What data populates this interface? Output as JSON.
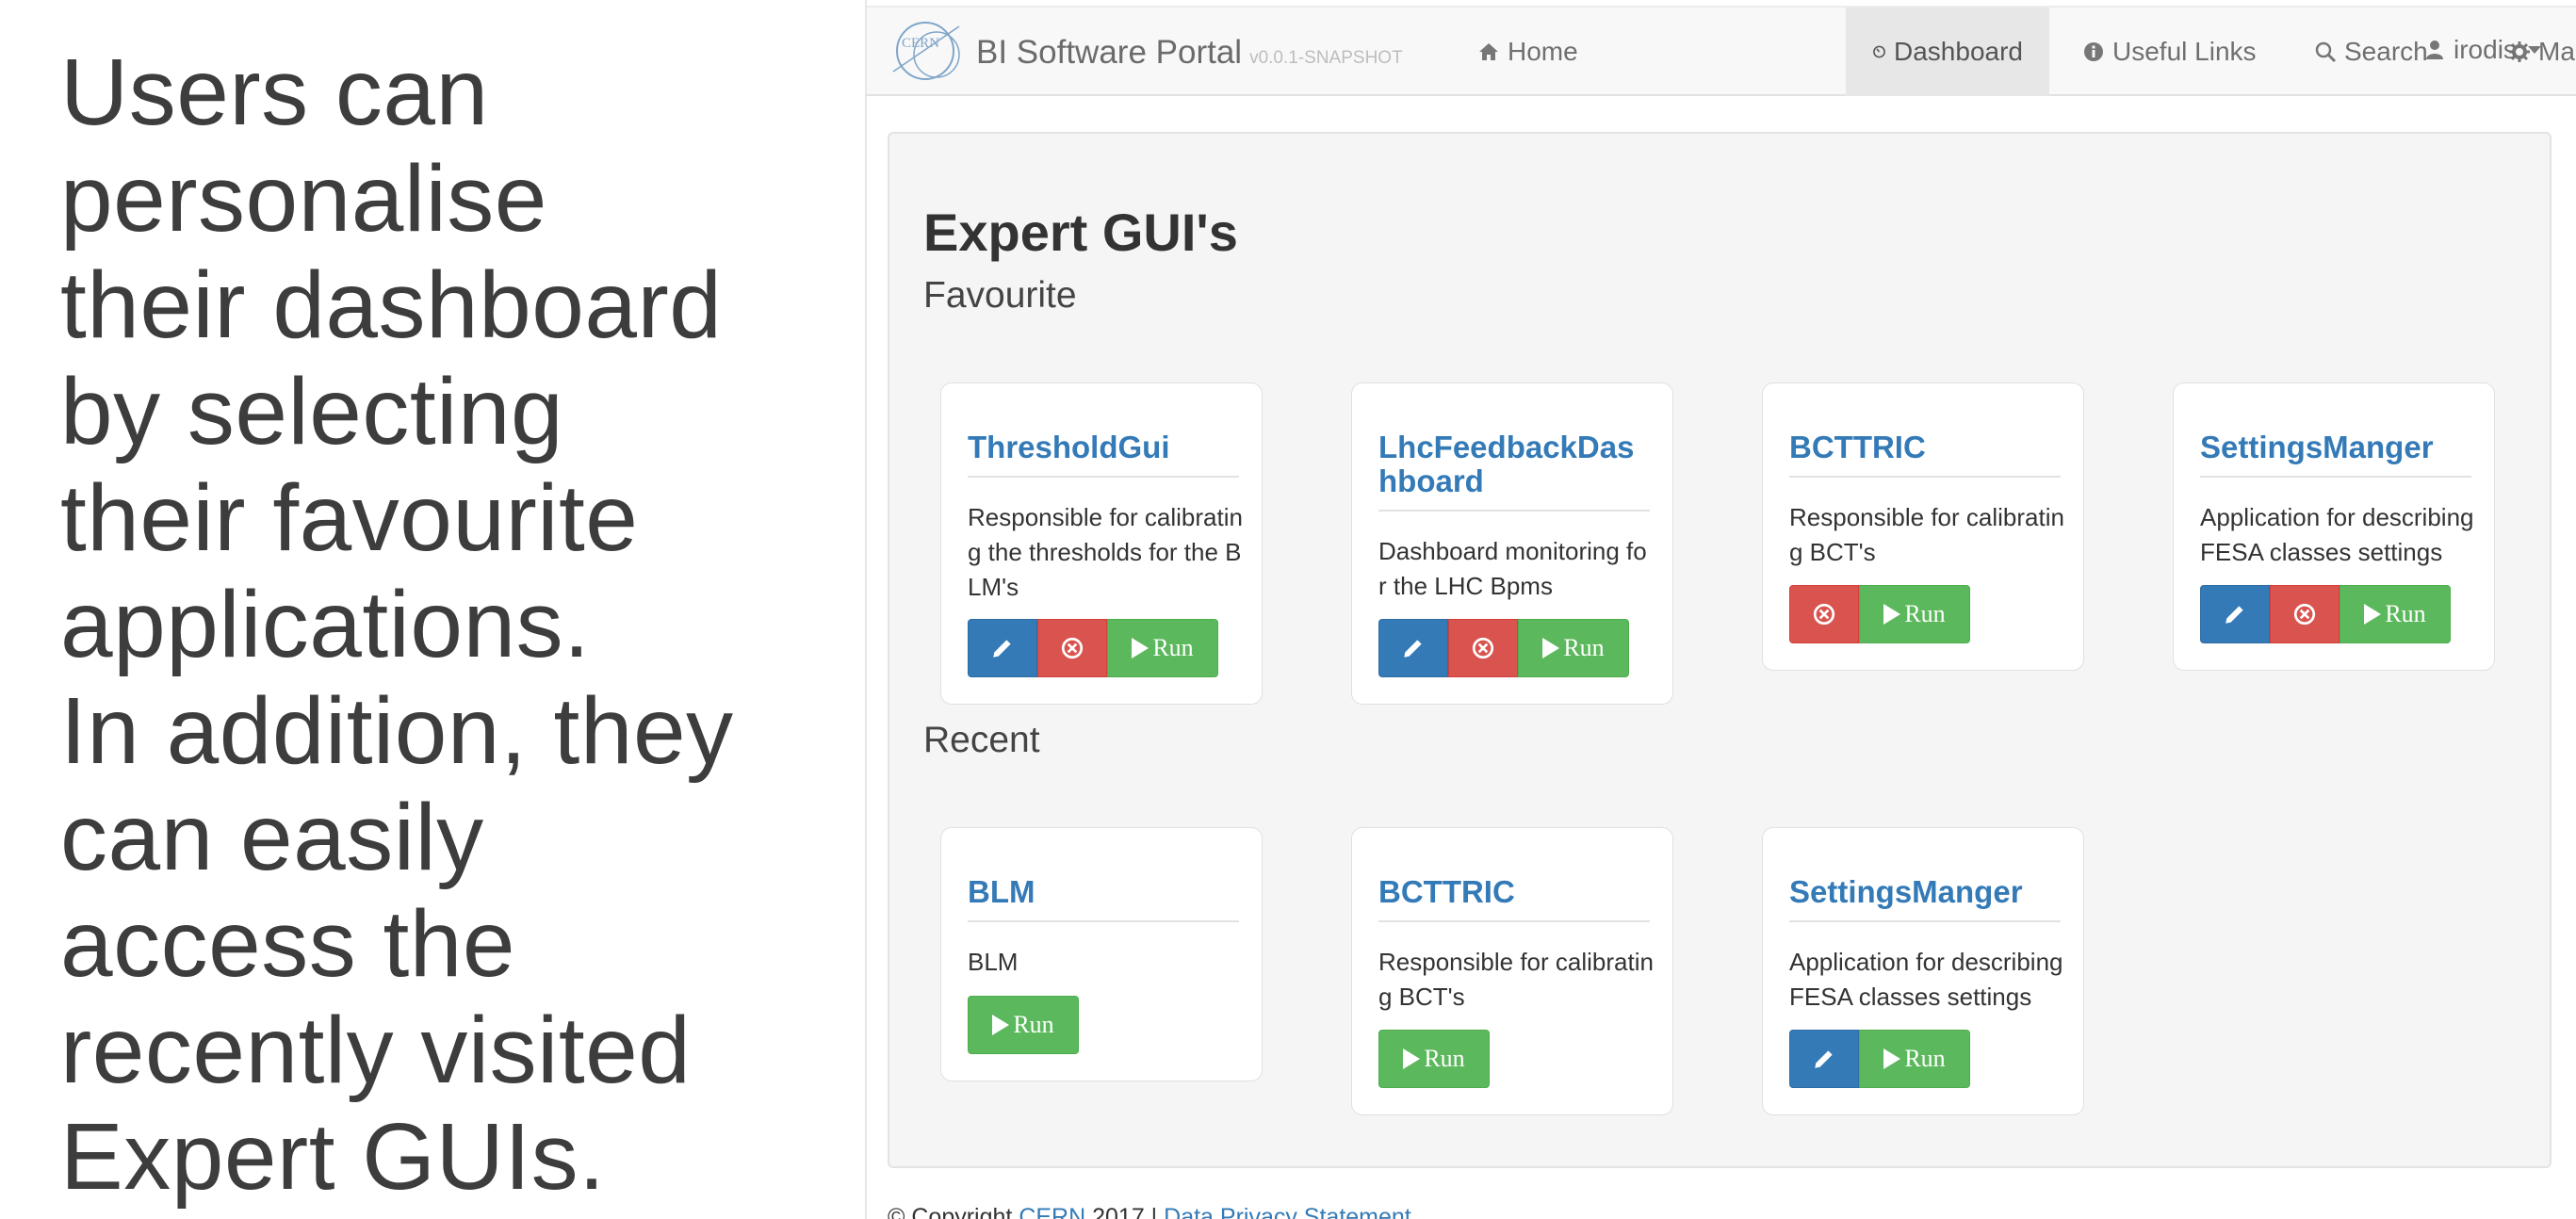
{
  "caption": {
    "lines": [
      "Users can",
      "personalise",
      "their dashboard",
      "by selecting",
      "their favourite",
      "applications.",
      "In addition, they",
      "can easily",
      "access the",
      "recently visited",
      "Expert GUIs."
    ]
  },
  "navbar": {
    "brand": "BI Software Portal",
    "version": "v0.0.1-SNAPSHOT",
    "logo_text": "CERN",
    "items": [
      {
        "label": "Home",
        "icon": "home-icon"
      },
      {
        "label": "Dashboard",
        "icon": "dashboard-icon",
        "active": true
      },
      {
        "label": "Useful Links",
        "icon": "info-icon"
      },
      {
        "label": "Search",
        "icon": "search-icon"
      },
      {
        "label": "Manage",
        "icon": "gear-icon",
        "dropdown": true
      },
      {
        "label": "irodis",
        "icon": "user-icon",
        "dropdown": true
      }
    ]
  },
  "page": {
    "title": "Expert GUI's",
    "favourite_heading": "Favourite",
    "recent_heading": "Recent"
  },
  "favourites": [
    {
      "title": "ThresholdGui",
      "description": "Responsible for calibrating the thresholds for the BLM's",
      "buttons": [
        "edit",
        "remove",
        "run"
      ]
    },
    {
      "title": "LhcFeedbackDashboard",
      "description": "Dashboard monitoring for the LHC Bpms",
      "buttons": [
        "edit",
        "remove",
        "run"
      ]
    },
    {
      "title": "BCTTRIC",
      "description": "Responsible for calibrating BCT's",
      "buttons": [
        "remove",
        "run"
      ]
    },
    {
      "title": "SettingsManger",
      "description": "Application for describing FESA classes settings",
      "buttons": [
        "edit",
        "remove",
        "run"
      ]
    }
  ],
  "recent": [
    {
      "title": "BLM",
      "description": "BLM",
      "buttons": [
        "run"
      ]
    },
    {
      "title": "BCTTRIC",
      "description": "Responsible for calibrating BCT's",
      "buttons": [
        "run"
      ]
    },
    {
      "title": "SettingsManger",
      "description": "Application for describing FESA classes settings",
      "buttons": [
        "edit",
        "run"
      ]
    }
  ],
  "buttons": {
    "run_label": "Run"
  },
  "footer": {
    "copyright_prefix": "© Copyright",
    "cern_link": "CERN",
    "year_sep": "2017 |",
    "privacy_link": "Data Privacy Statement"
  },
  "colors": {
    "primary": "#337ab7",
    "danger": "#d9534f",
    "success": "#5cb85c",
    "navbar_bg": "#f8f8f8",
    "well_bg": "#f5f5f5"
  }
}
